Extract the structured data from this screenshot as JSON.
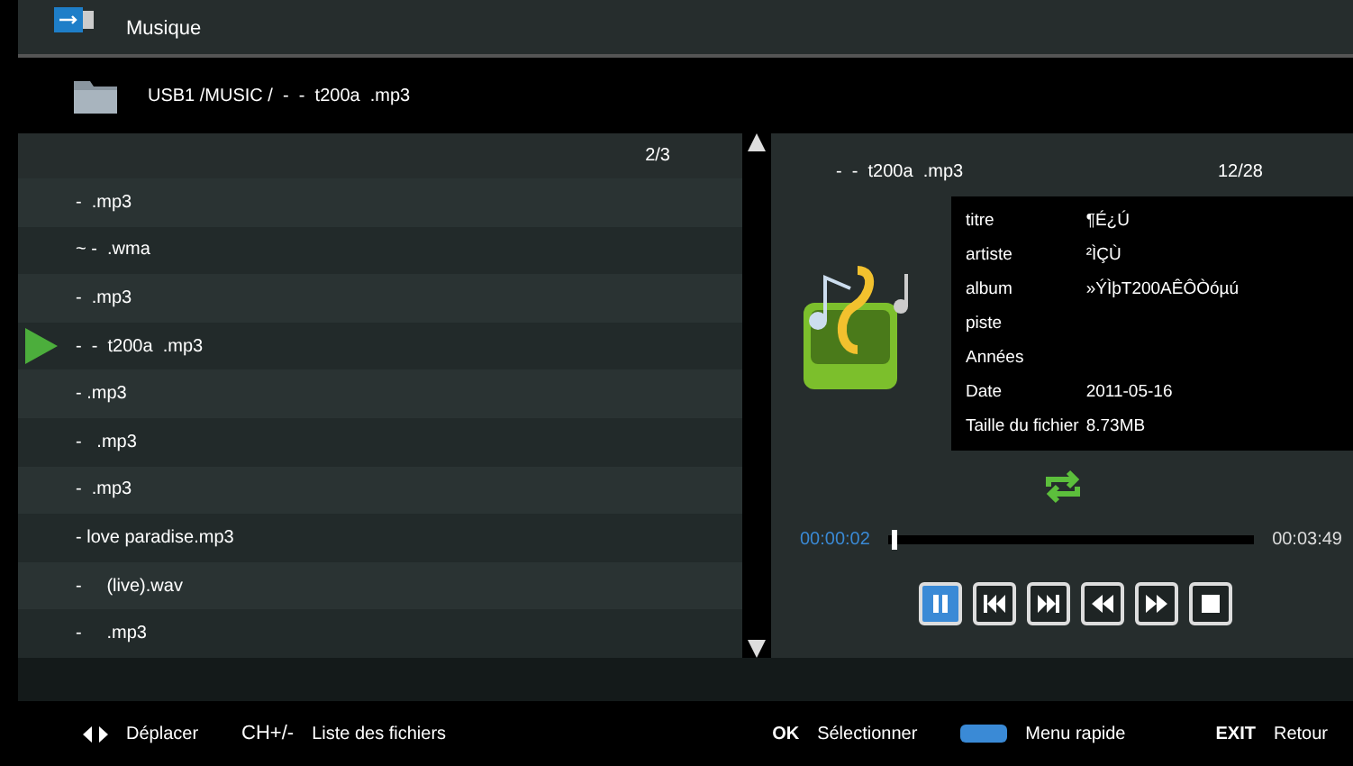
{
  "header": {
    "title": "Musique"
  },
  "path": "USB1 /MUSIC /  -  -  t200a  .mp3",
  "file_list": {
    "page": "2/3",
    "items": [
      {
        "name": "-  .mp3",
        "playing": false
      },
      {
        "name": "~ -  .wma",
        "playing": false
      },
      {
        "name": "-  .mp3",
        "playing": false
      },
      {
        "name": "-  -  t200a  .mp3",
        "playing": true
      },
      {
        "name": "- .mp3",
        "playing": false
      },
      {
        "name": "-   .mp3",
        "playing": false
      },
      {
        "name": "-  .mp3",
        "playing": false
      },
      {
        "name": "- love paradise.mp3",
        "playing": false
      },
      {
        "name": "-     (live).wav",
        "playing": false
      },
      {
        "name": "-     .mp3",
        "playing": false
      }
    ]
  },
  "now_playing": {
    "file": "-  -  t200a  .mp3",
    "index": "12/28",
    "info": [
      {
        "label": "titre",
        "value": "¶É¿Ú"
      },
      {
        "label": "artiste",
        "value": "²ÌÇÙ"
      },
      {
        "label": "album",
        "value": "»ÝÌþT200AÊÔÒóµú"
      },
      {
        "label": "piste"
      },
      {
        "label": "Années"
      },
      {
        "label": "Date",
        "value": "2011-05-16"
      },
      {
        "label": "Taille du fichier",
        "value": "8.73MB"
      }
    ],
    "repeat": true,
    "elapsed": "00:00:02",
    "duration": "00:03:49",
    "level": 0.01,
    "controls": [
      {
        "kind": "pause",
        "selected": true
      },
      {
        "kind": "prev",
        "selected": false
      },
      {
        "kind": "next",
        "selected": false
      },
      {
        "kind": "rewind",
        "selected": false
      },
      {
        "kind": "forward",
        "selected": false
      },
      {
        "kind": "stop",
        "selected": false
      }
    ]
  },
  "footer": [
    {
      "kind": "arrows",
      "label": "Déplacer"
    },
    {
      "kind": "text",
      "key": "CH+/-",
      "label": "Liste des fichiers"
    },
    {
      "kind": "spacer"
    },
    {
      "kind": "bold",
      "key": "OK",
      "label": "Sélectionner"
    },
    {
      "kind": "blue",
      "label": "Menu rapide"
    },
    {
      "kind": "bold",
      "key": "EXIT",
      "label": "Retour"
    }
  ]
}
